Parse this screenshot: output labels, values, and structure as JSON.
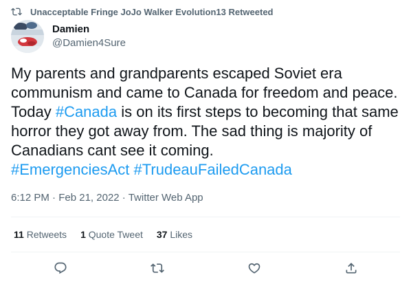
{
  "retweet_context": {
    "text": "Unacceptable Fringe JoJo Walker Evolution13 Retweeted",
    "icon": "retweet-icon"
  },
  "author": {
    "display_name": "Damien",
    "handle": "@Damien4Sure"
  },
  "tweet": {
    "text_segments": [
      {
        "type": "text",
        "value": "My parents and grandparents escaped Soviet era communism and came to Canada for freedom and peace. Today "
      },
      {
        "type": "hashtag",
        "value": "#Canada"
      },
      {
        "type": "text",
        "value": " is on its first steps to becoming that same horror they got away from. The sad thing is majority of Canadians cant see it coming.\n"
      },
      {
        "type": "hashtag",
        "value": "#EmergenciesAct"
      },
      {
        "type": "text",
        "value": " "
      },
      {
        "type": "hashtag",
        "value": "#TrudeauFailedCanada"
      }
    ],
    "time": "6:12 PM",
    "separator": "·",
    "date": "Feb 21, 2022",
    "source": "Twitter Web App"
  },
  "stats": {
    "retweets_count": "11",
    "retweets_label": "Retweets",
    "quote_count": "1",
    "quote_label": "Quote Tweet",
    "likes_count": "37",
    "likes_label": "Likes"
  },
  "actions": {
    "reply_icon": "reply-icon",
    "retweet_icon": "retweet-icon",
    "like_icon": "heart-icon",
    "share_icon": "share-icon"
  },
  "colors": {
    "hashtag": "#1d9bf0",
    "secondary_text": "#536471",
    "primary_text": "#0f1419",
    "divider": "#eff3f4"
  }
}
